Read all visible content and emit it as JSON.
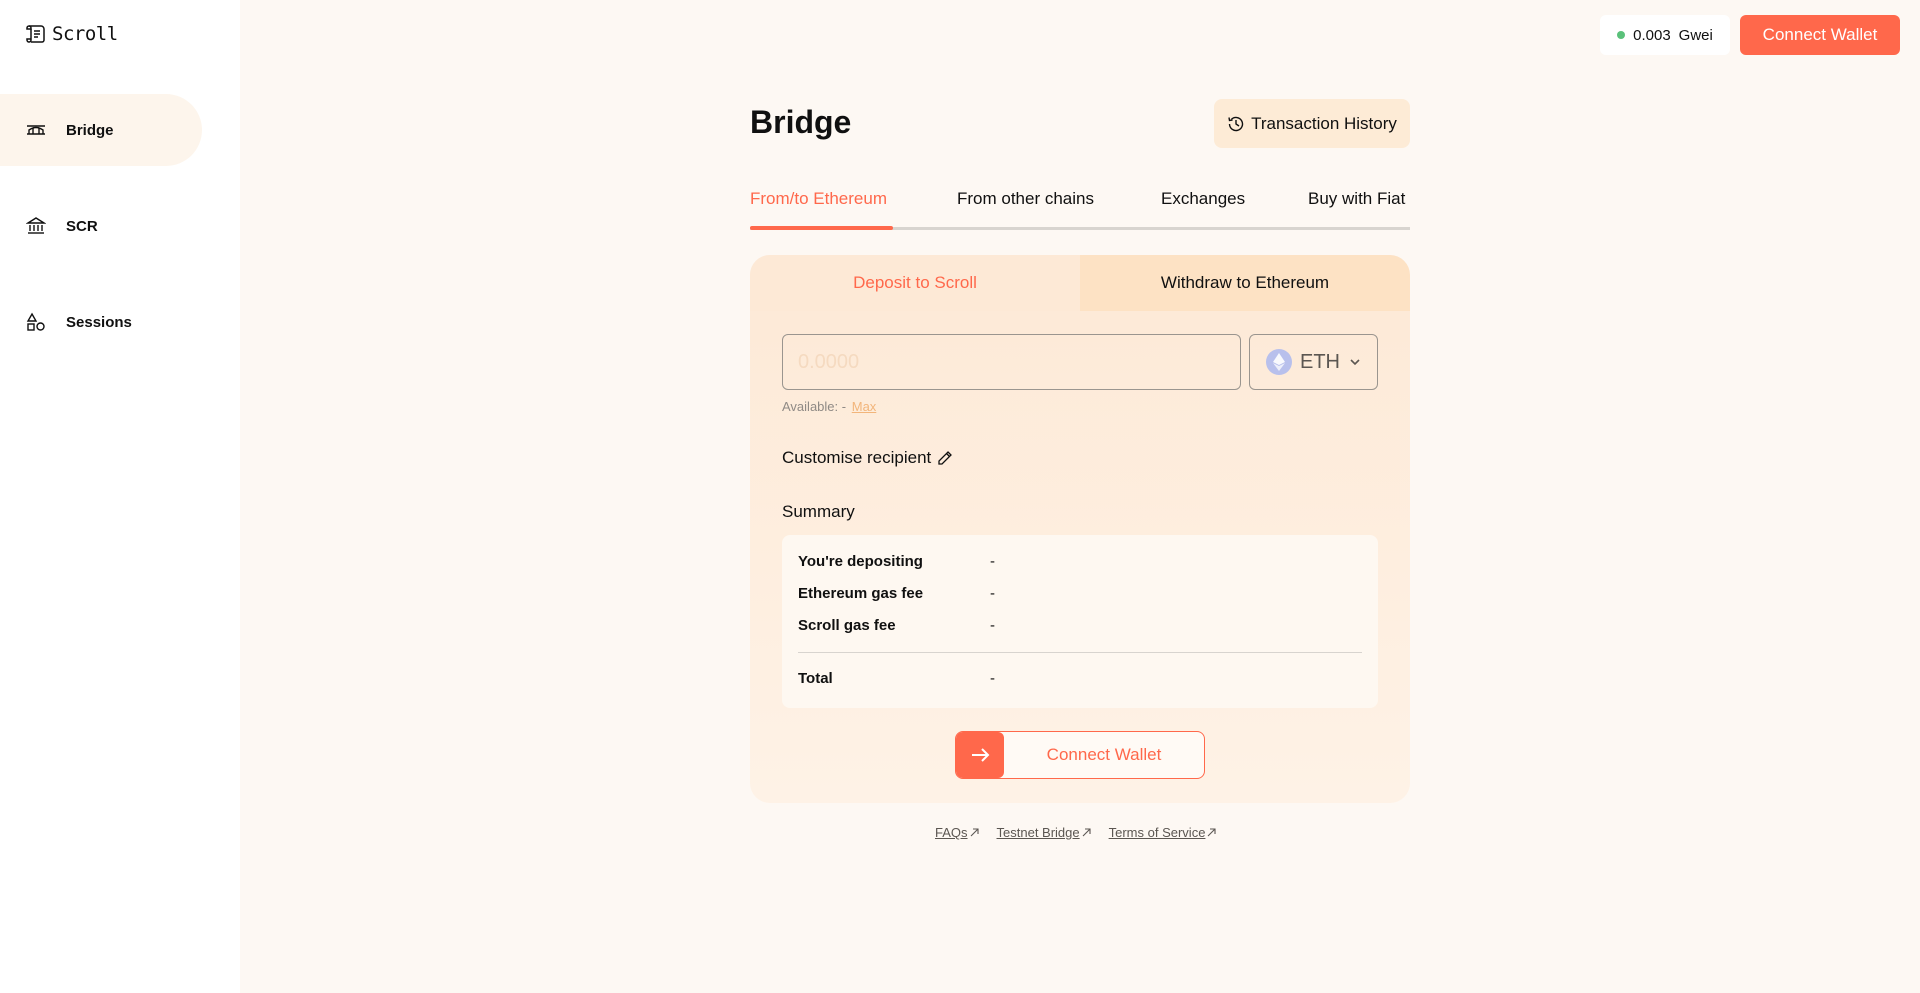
{
  "app": {
    "name": "Scroll"
  },
  "sidebar": {
    "items": [
      {
        "label": "Bridge",
        "icon": "bridge-icon",
        "active": true
      },
      {
        "label": "SCR",
        "icon": "bank-icon",
        "active": false
      },
      {
        "label": "Sessions",
        "icon": "shapes-icon",
        "active": false
      }
    ]
  },
  "topbar": {
    "gas_value": "0.003",
    "gas_unit": "Gwei",
    "connect_label": "Connect Wallet"
  },
  "page": {
    "title": "Bridge",
    "history_label": "Transaction History"
  },
  "tabs": [
    {
      "label": "From/to Ethereum",
      "active": true
    },
    {
      "label": "From other chains",
      "active": false
    },
    {
      "label": "Exchanges",
      "active": false
    },
    {
      "label": "Buy with Fiat",
      "active": false
    }
  ],
  "form": {
    "mode_deposit": "Deposit to Scroll",
    "mode_withdraw": "Withdraw to Ethereum",
    "amount_placeholder": "0.0000",
    "token": "ETH",
    "available_label": "Available:",
    "available_value": "-",
    "max_label": "Max",
    "recipient_label": "Customise recipient",
    "summary_label": "Summary",
    "summary_rows": [
      {
        "label": "You're depositing",
        "value": "-"
      },
      {
        "label": "Ethereum gas fee",
        "value": "-"
      },
      {
        "label": "Scroll gas fee",
        "value": "-"
      }
    ],
    "total_label": "Total",
    "total_value": "-",
    "connect_label": "Connect Wallet"
  },
  "footer": {
    "links": [
      "FAQs",
      "Testnet Bridge",
      "Terms of Service"
    ]
  },
  "colors": {
    "accent": "#ff684b",
    "background": "#fdf8f3",
    "gas_indicator": "#5ac17a"
  }
}
